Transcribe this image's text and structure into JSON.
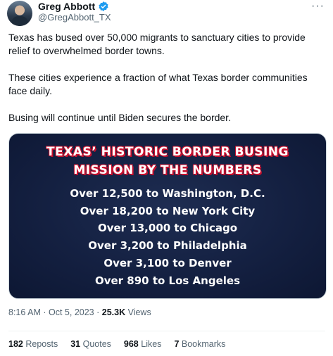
{
  "author": {
    "name": "Greg Abbott",
    "handle": "@GregAbbott_TX"
  },
  "icons": {
    "more": "more-dots-icon",
    "verified": "verified-badge-icon"
  },
  "colors": {
    "accent": "#1d9bf0",
    "card_bg": "#142041",
    "title_shadow": "#c8102e"
  },
  "tweet": {
    "paragraphs": [
      "Texas has bused over 50,000 migrants to sanctuary cities to provide relief to overwhelmed border towns.",
      "These cities experience a fraction of what Texas border communities face daily.",
      "Busing will continue until Biden secures the border."
    ]
  },
  "card": {
    "title_line1": "TEXAS’ HISTORIC BORDER BUSING",
    "title_line2": "MISSION BY THE NUMBERS",
    "stats": [
      "Over 12,500 to Washington, D.C.",
      "Over 18,200 to New York City",
      "Over 13,000 to Chicago",
      "Over 3,200 to Philadelphia",
      "Over 3,100 to Denver",
      "Over 890 to Los Angeles"
    ]
  },
  "meta": {
    "time": "8:16 AM",
    "date": "Oct 5, 2023",
    "views_count": "25.3K",
    "views_label": "Views"
  },
  "engagement": {
    "reposts_count": "182",
    "reposts_label": "Reposts",
    "quotes_count": "31",
    "quotes_label": "Quotes",
    "likes_count": "968",
    "likes_label": "Likes",
    "bookmarks_count": "7",
    "bookmarks_label": "Bookmarks"
  }
}
